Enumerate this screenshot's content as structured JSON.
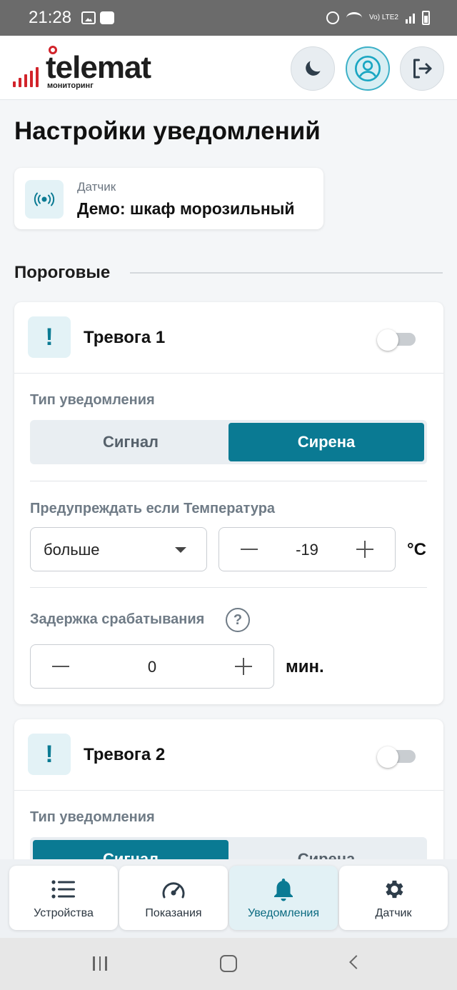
{
  "status_bar": {
    "time": "21:28",
    "network": "Vo) LTE2"
  },
  "header": {
    "logo_text": "telemat",
    "logo_sub": "мониторинг",
    "brand_color": "#d2232a",
    "accent_color": "#0a7a93"
  },
  "page": {
    "title": "Настройки уведомлений"
  },
  "sensor": {
    "label": "Датчик",
    "name": "Демо: шкаф морозильный"
  },
  "section": {
    "title": "Пороговые"
  },
  "alarm1": {
    "icon": "!",
    "title": "Тревога 1",
    "enabled": false,
    "type_label": "Тип уведомления",
    "type_options": [
      "Сигнал",
      "Сирена"
    ],
    "type_selected": "Сирена",
    "condition_label": "Предупреждать если Температура",
    "comparison": "больше",
    "threshold": "-19",
    "threshold_unit": "°C",
    "delay_label": "Задержка срабатывания",
    "help_icon": "?",
    "delay": "0",
    "delay_unit": "мин."
  },
  "alarm2": {
    "icon": "!",
    "title": "Тревога 2",
    "enabled": false,
    "type_label": "Тип уведомления",
    "type_options": [
      "Сигнал",
      "Сирена"
    ],
    "type_selected": "Сигнал"
  },
  "bottom_nav": [
    {
      "label": "Устройства",
      "icon": "list-icon",
      "active": false
    },
    {
      "label": "Показания",
      "icon": "gauge-icon",
      "active": false
    },
    {
      "label": "Уведомления",
      "icon": "bell-icon",
      "active": true
    },
    {
      "label": "Датчик",
      "icon": "gear-icon",
      "active": false
    }
  ]
}
